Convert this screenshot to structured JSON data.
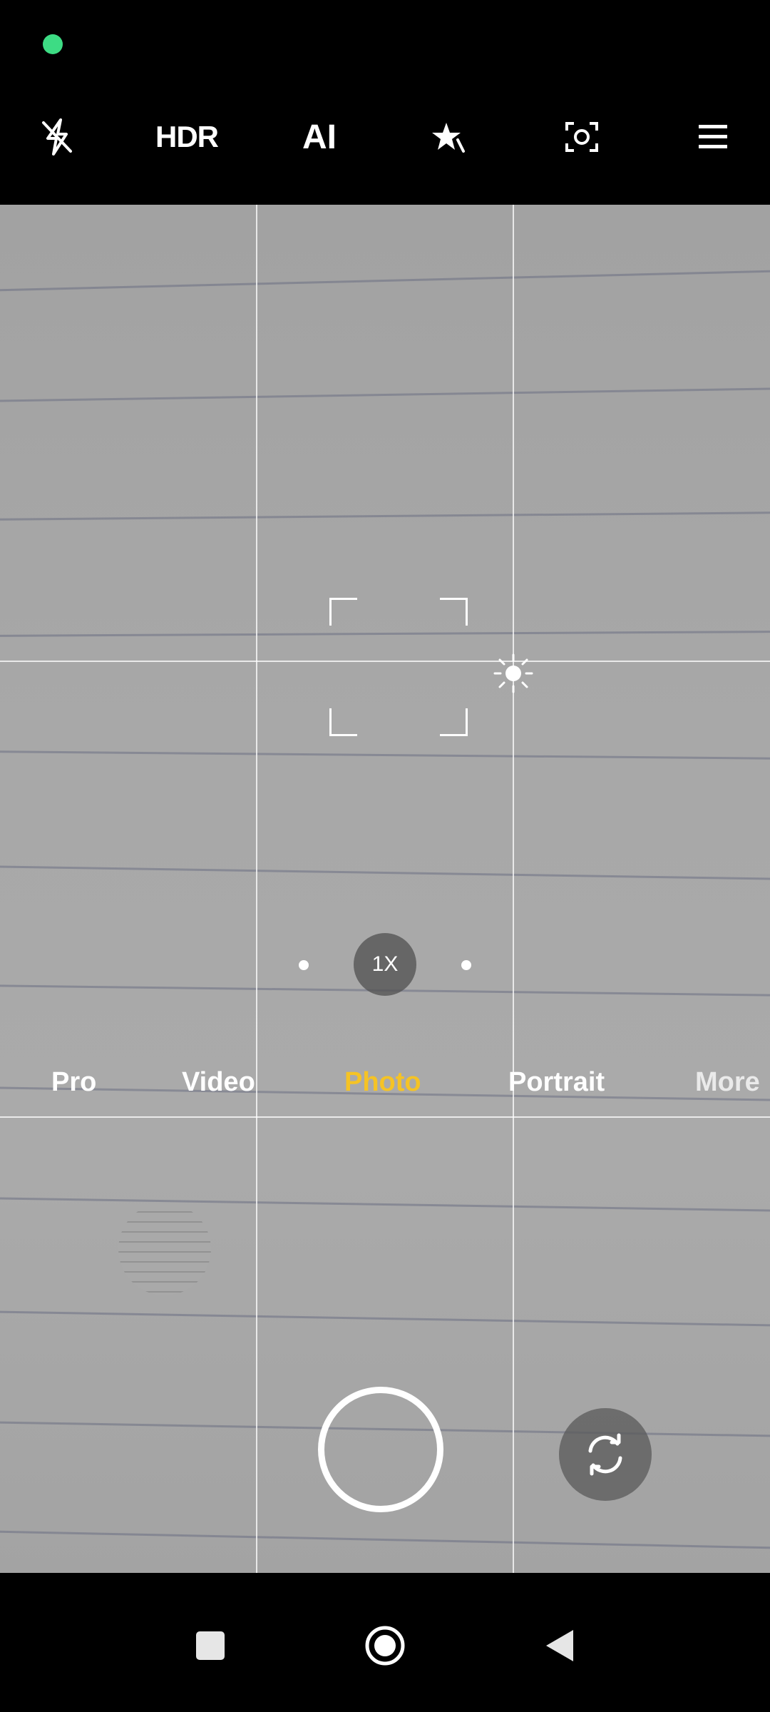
{
  "status_bar": {
    "indicator_color": "#3ddc84",
    "indicator_icon": "privacy-dot"
  },
  "top_bar": {
    "flash_icon": "flash-off-icon",
    "hdr_label": "HDR",
    "ai_label": "AI",
    "beauty_icon": "beauty-star-icon",
    "lens_icon": "focus-frame-icon",
    "menu_icon": "hamburger-icon"
  },
  "viewfinder": {
    "grid": "3x3",
    "subject": "lined paper"
  },
  "zoom": {
    "label": "1X"
  },
  "modes": [
    {
      "label": "Pro"
    },
    {
      "label": "Video"
    },
    {
      "label": "Photo",
      "active": true
    },
    {
      "label": "Portrait"
    },
    {
      "label": "More"
    }
  ],
  "controls": {
    "gallery_icon": "gallery-thumbnail",
    "shutter_icon": "shutter-button",
    "flip_icon": "switch-camera-icon"
  },
  "navbar": {
    "recents_icon": "recents-square-icon",
    "home_icon": "home-circle-icon",
    "back_icon": "back-triangle-icon"
  },
  "colors": {
    "accent": "#f5c325",
    "bar_bg": "#000000",
    "text": "#ffffff"
  }
}
